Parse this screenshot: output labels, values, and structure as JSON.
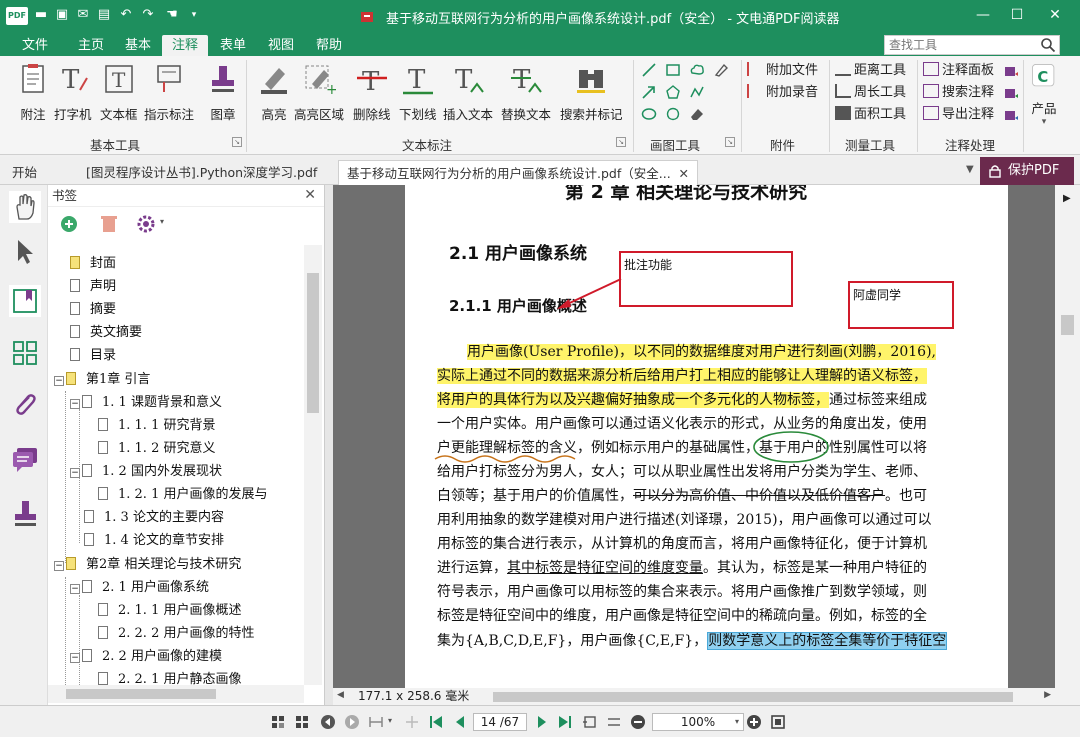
{
  "window": {
    "title": "基于移动互联网行为分析的用户画像系统设计.pdf（安全） - 文电通PDF阅读器",
    "logo": "PDF"
  },
  "menu": [
    "文件",
    "主页",
    "基本",
    "注释",
    "表单",
    "视图",
    "帮助"
  ],
  "menu_active": "注释",
  "search": {
    "placeholder": "查找工具"
  },
  "ribbon": {
    "basic": {
      "items": [
        "附注",
        "打字机",
        "文本框",
        "指示标注",
        "图章"
      ],
      "label": "基本工具"
    },
    "text": {
      "items": [
        "高亮",
        "高亮区域",
        "删除线",
        "下划线",
        "插入文本",
        "替换文本",
        "搜索并标记"
      ],
      "label": "文本标注"
    },
    "draw": {
      "label": "画图工具"
    },
    "attach": {
      "items": [
        "附加文件",
        "附加录音"
      ],
      "label": "附件"
    },
    "measure": {
      "items": [
        "距离工具",
        "周长工具",
        "面积工具"
      ],
      "label": "测量工具"
    },
    "annot": {
      "items": [
        "注释面板",
        "搜索注释",
        "导出注释"
      ],
      "label": "注释处理"
    },
    "product": "产品"
  },
  "tabs": {
    "start": "开始",
    "doc1": "[图灵程序设计丛书].Python深度学习.pdf",
    "doc2": "基于移动互联网行为分析的用户画像系统设计.pdf（安全...",
    "protect": "保护PDF"
  },
  "bookmarks": {
    "title": "书签",
    "items": [
      {
        "text": "封面"
      },
      {
        "text": "声明"
      },
      {
        "text": "摘要"
      },
      {
        "text": "英文摘要"
      },
      {
        "text": "目录"
      },
      {
        "text": "第1章 引言"
      },
      {
        "text": "1. 1 课题背景和意义"
      },
      {
        "text": "1. 1. 1 研究背景"
      },
      {
        "text": "1. 1. 2 研究意义"
      },
      {
        "text": "1. 2 国内外发展现状"
      },
      {
        "text": "1. 2. 1 用户画像的发展与"
      },
      {
        "text": "1. 3 论文的主要内容"
      },
      {
        "text": "1. 4 论文的章节安排"
      },
      {
        "text": "第2章 相关理论与技术研究"
      },
      {
        "text": "2. 1 用户画像系统"
      },
      {
        "text": "2. 1. 1 用户画像概述"
      },
      {
        "text": "2. 2. 2 用户画像的特性"
      },
      {
        "text": "2. 2 用户画像的建模"
      },
      {
        "text": "2. 2. 1 用户静态画像"
      }
    ]
  },
  "doc": {
    "chapter_partial": "第 2 章 相关理论与技术研究",
    "h2": "2.1  用户画像系统",
    "h3": "2.1.1  用户画像概述",
    "annot1": "批注功能",
    "annot2": "阿虚同学",
    "p": {
      "l1": "用户画像(User Profile)，以不同的数据维度对用户进行刻画(刘鹏，2016),",
      "l2": "实际上通过不同的数据来源分析后给用户打上相应的能够让人理解的语义标签，",
      "l3a": "将用户的具体行为以及兴趣偏好抽象成一个多元化的人物标签，",
      "l3b": "通过标签来组成",
      "l4": "一个用户实体。用户画像可以通过语义化表示的形式，从业务的角度出发，使用",
      "l5a": "户更能理解标签的含义",
      "l5b": "，例如标示用户的基础属性，",
      "l5c": "基于用户",
      "l5d": "的性别属性可以将",
      "l6": "给用户打标签分为男人，女人；可以从职业属性出发将用户分类为学生、老师、",
      "l7a": "白领等；基于用户的价值属性，",
      "l7b": "可以分为高价值、中价值以及低价值客户",
      "l7c": "。也可",
      "l8": "用利用抽象的数学建模对用户进行描述(刘译璟，2015)，用户画像可以通过可以",
      "l9": "用标签的集合进行表示，从计算机的角度而言，将用户画像特征化，便于计算机",
      "l10a": "进行运算，",
      "l10b": "其中标签是特征空间的维度变量",
      "l10c": "。其认为，标签是某一种用户特征的",
      "l11": "符号表示，用户画像可以用标签的集合来表示。将用户画像推广到数学领域，则",
      "l12": "标签是特征空间中的维度，用户画像是特征空间中的稀疏向量。例如，标签的全",
      "l13a": "集为{A,B,C,D,E,F}，用户画像{C,E,F}，",
      "l13b": "则数学意义上的标签全集等价于特征空"
    }
  },
  "status": {
    "size": "177.1 x 258.6 毫米",
    "page": "14 /67",
    "zoom": "100%"
  },
  "colors": {
    "brand": "#1e8f5e",
    "protect": "#6b2a4d",
    "annot_red": "#d01a2a",
    "highlight": "#fff46a",
    "highlight_blue": "#8fd0f0"
  }
}
